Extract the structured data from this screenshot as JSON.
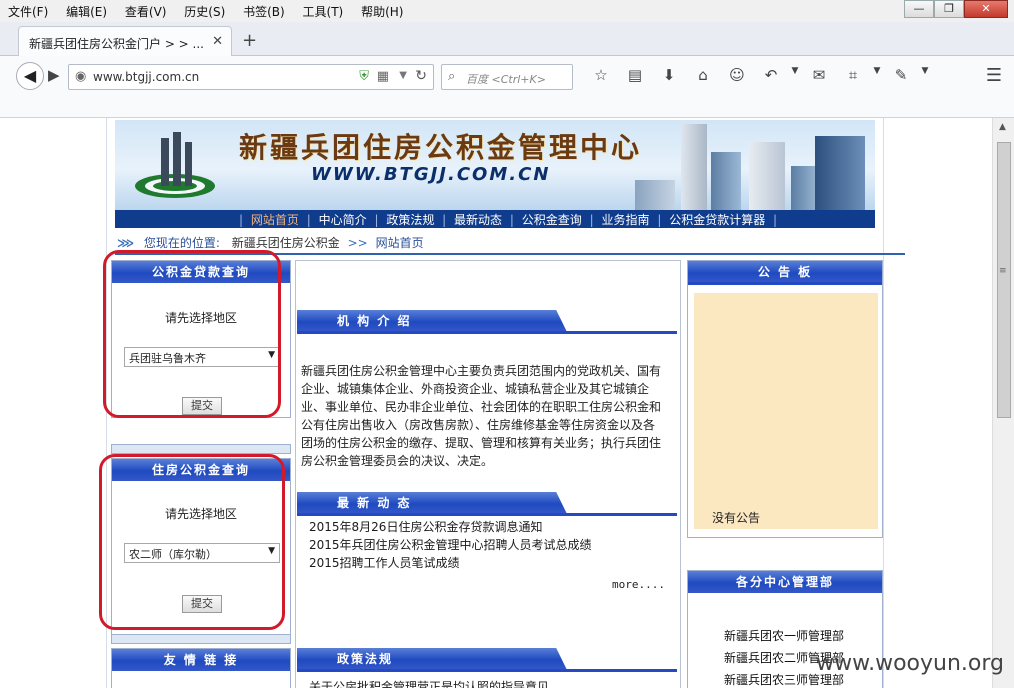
{
  "browser": {
    "menu": [
      "文件(F)",
      "编辑(E)",
      "查看(V)",
      "历史(S)",
      "书签(B)",
      "工具(T)",
      "帮助(H)"
    ],
    "tab_title": "新疆兵团住房公积金门户 > > ...",
    "url": "www.btgjj.com.cn",
    "search_placeholder": "百度 <Ctrl+K>",
    "window_buttons": [
      "—",
      "❐",
      "✕"
    ]
  },
  "banner": {
    "title": "新疆兵团住房公积金管理中心",
    "url": "WWW.BTGJJ.COM.CN"
  },
  "nav": {
    "items": [
      "网站首页",
      "中心简介",
      "政策法规",
      "最新动态",
      "公积金查询",
      "业务指南",
      "公积金贷款计算器"
    ],
    "active_index": 0
  },
  "breadcrumb": {
    "label": "您现在的位置:",
    "site": "新疆兵团住房公积金",
    "sep": ">>",
    "current": "网站首页"
  },
  "loan_query": {
    "title": "公积金贷款查询",
    "prompt": "请先选择地区",
    "selected": "兵团驻乌鲁木齐",
    "submit": "提交"
  },
  "fund_query": {
    "title": "住房公积金查询",
    "prompt": "请先选择地区",
    "selected": "农二师（库尔勒）",
    "submit": "提交"
  },
  "links_box": {
    "title": "友 情 链 接"
  },
  "intro": {
    "title": "机 构 介 绍",
    "text": "新疆兵团住房公积金管理中心主要负责兵团范围内的党政机关、国有企业、城镇集体企业、外商投资企业、城镇私营企业及其它城镇企业、事业单位、民办非企业单位、社会团体的在职职工住房公积金和公有住房出售收入（房改售房款）、住房维修基金等住房资金以及各团场的住房公积金的缴存、提取、管理和核算有关业务；执行兵团住房公积金管理委员会的决议、决定。"
  },
  "news": {
    "title": "最 新 动 态",
    "items": [
      "2015年8月26日住房公积金存贷款调息通知",
      "2015年兵团住房公积金管理中心招聘人员考试总成绩",
      "2015招聘工作人员笔试成绩"
    ],
    "more": "more...."
  },
  "policy": {
    "title": "政策法规",
    "partial_item": "关于公房批积金管理营正是均认照的指导意见"
  },
  "notice": {
    "title": "公 告 板",
    "text": "没有公告"
  },
  "branches": {
    "title": "各分中心管理部",
    "items": [
      "新疆兵团农一师管理部",
      "新疆兵团农二师管理部",
      "新疆兵团农三师管理部"
    ]
  },
  "watermark": "www.wooyun.org",
  "colors": {
    "nav_bg": "#0f3c8c",
    "box_header": "#1f4ac0",
    "highlight_ring": "#d21b2a",
    "notice_bg": "#fbe8c0"
  }
}
